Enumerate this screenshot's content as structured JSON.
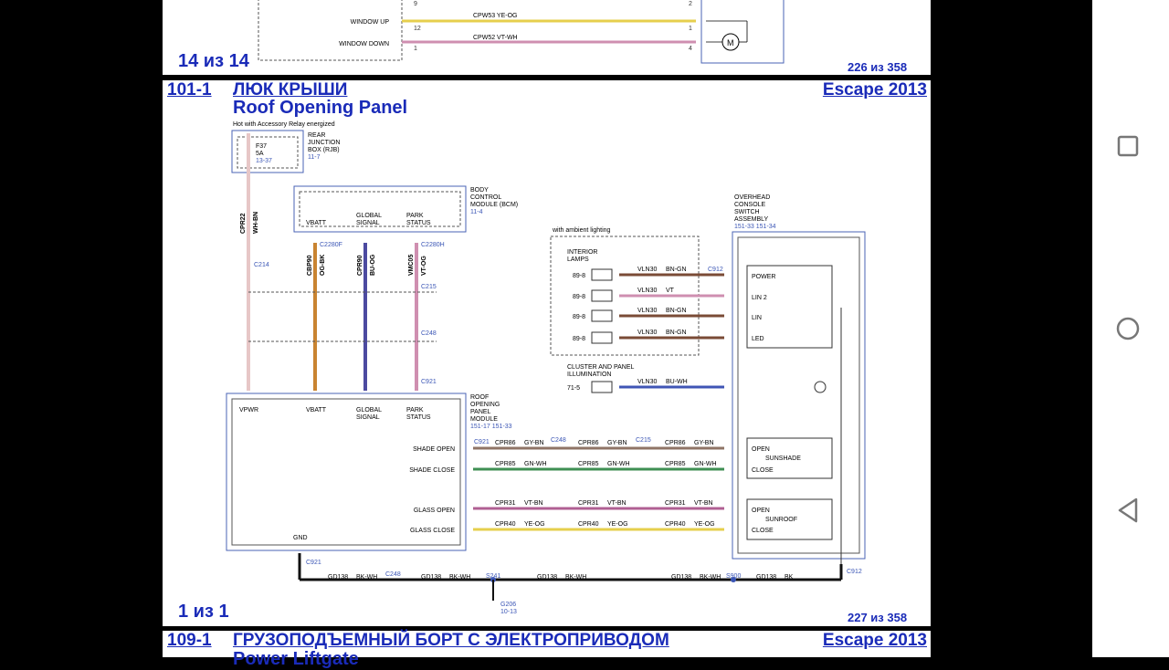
{
  "top_page": {
    "window_up_label": "WINDOW UP",
    "window_down_label": "WINDOW DOWN",
    "wire_up": "CPW53 YE-OG",
    "wire_down": "CPW52 VT-WH",
    "pin_up_left": "12",
    "pin_down_left": "1",
    "pin_up_right": "1",
    "pin_down_right": "4",
    "pin_top_left": "9",
    "pin_top_right": "2",
    "motor_symbol": "M",
    "page_counter": "14 из 14",
    "page_of": "226 из 358"
  },
  "main": {
    "section_id": "101-1",
    "title_ru": "ЛЮК КРЫШИ",
    "title_en": "Roof Opening Panel",
    "vehicle": "Escape 2013",
    "hot_note": "Hot with Accessory Relay energized",
    "rjb": {
      "fuse": "F37",
      "amp": "5A",
      "ref": "13-37",
      "line1": "REAR",
      "line2": "JUNCTION",
      "line3": "BOX (RJB)",
      "ref2": "11-7"
    },
    "bcm": {
      "line1": "BODY",
      "line2": "CONTROL",
      "line3": "MODULE (BCM)",
      "ref": "11-4",
      "vbatt": "VBATT",
      "global1": "GLOBAL",
      "global2": "SIGNAL",
      "park1": "PARK",
      "park2": "STATUS"
    },
    "connectors": {
      "c214": "C214",
      "c2280f": "C2280F",
      "c2280h": "C2280H",
      "c215": "C215",
      "c248": "C248",
      "c921": "C921",
      "c912": "C912",
      "s241": "S241",
      "s900": "S900",
      "g206": "G206",
      "g206_ref": "10-13"
    },
    "wires": {
      "cpr22": "CPR22",
      "wh_bn": "WH-BN",
      "cbp90": "CBP90",
      "og_bk": "OG-BK",
      "cpr90": "CPR90",
      "bu_og": "BU-OG",
      "vmc05": "VMC05",
      "vt_og": "VT-OG"
    },
    "rop_module": {
      "line1": "ROOF",
      "line2": "OPENING",
      "line3": "PANEL",
      "line4": "MODULE",
      "ref": "151-17  151-33",
      "vpwr": "VPWR",
      "gnd": "GND",
      "shade_open": "SHADE OPEN",
      "shade_close": "SHADE CLOSE",
      "glass_open": "GLASS OPEN",
      "glass_close": "GLASS CLOSE"
    },
    "signal_wires": {
      "cpr86": "CPR86",
      "gy_bn": "GY-BN",
      "cpr85": "CPR85",
      "gn_wh": "GN-WH",
      "cpr31": "CPR31",
      "vt_bn": "VT-BN",
      "cpr40": "CPR40",
      "ye_og": "YE-OG"
    },
    "interior": {
      "ambient": "with ambient lighting",
      "label1": "INTERIOR",
      "label2": "LAMPS",
      "pin": "89-8",
      "vln30": "VLN30",
      "bn_gn": "BN-GN",
      "vt": "VT",
      "cluster1": "CLUSTER AND PANEL",
      "cluster2": "ILLUMINATION",
      "cluster_pin": "71-5",
      "bu_wh": "BU-WH"
    },
    "overhead": {
      "line1": "OVERHEAD",
      "line2": "CONSOLE",
      "line3": "SWITCH",
      "line4": "ASSEMBLY",
      "ref": "151-33  151-34",
      "power": "POWER",
      "lin2": "LIN 2",
      "lin": "LIN",
      "led": "LED",
      "open": "OPEN",
      "sunshade": "SUNSHADE",
      "close": "CLOSE",
      "sunroof": "SUNROOF"
    },
    "ground_wires": {
      "gd138": "GD138",
      "bk_wh": "BK-WH",
      "bk": "BK"
    },
    "page_counter": "1 из 1",
    "page_of": "227 из 358"
  },
  "next_page": {
    "section_id": "109-1",
    "title_ru": "ГРУЗОПОДЪЕМНЫЙ БОРТ С ЭЛЕКТРОПРИВОДОМ",
    "title_en": "Power Liftgate",
    "vehicle": "Escape 2013"
  },
  "navigation": {
    "recent_icon": "square-icon",
    "home_icon": "circle-icon",
    "back_icon": "triangle-icon"
  },
  "colors": {
    "heading_blue": "#1a2bb8",
    "wire_yellow": "#e6cf4d",
    "wire_pink": "#cf8fb0",
    "wire_orange": "#c98431",
    "wire_blue": "#4c4aa0",
    "wire_brown": "#7a4b36",
    "wire_green": "#3f8f53",
    "wire_gray_brown": "#8f7466",
    "wire_violet": "#b05f93"
  }
}
